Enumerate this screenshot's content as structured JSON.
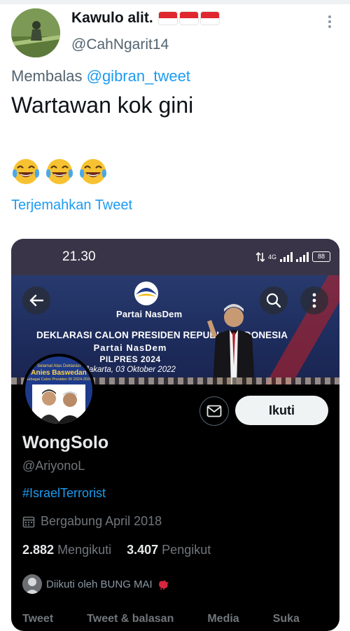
{
  "tweet": {
    "author_name": "Kawulo alit.",
    "author_handle": "@CahNgarit14",
    "reply_prefix": "Membalas",
    "reply_to": "@gibran_tweet",
    "text": "Wartawan kok gini",
    "emojis": [
      "face-with-tears-of-joy",
      "face-with-tears-of-joy",
      "face-with-tears-of-joy"
    ],
    "translate_label": "Terjemahkan Tweet"
  },
  "screenshot": {
    "status_time": "21.30",
    "network_label": "4G",
    "battery_level": "88",
    "banner": {
      "party_logo_text": "Partai NasDem",
      "title": "DEKLARASI CALON PRESIDEN REPUBLIK INDONESIA",
      "party": "Partai NasDem",
      "event": "PILPRES 2024",
      "date": "Jakarta, 03 Oktober 2022"
    },
    "profile_pic": {
      "tagline_top": "Selamat Atas Deklarasi",
      "name": "Anies Baswedan",
      "tagline_bottom": "Sebagai Calon Presiden RI 2024-2029"
    },
    "follow_label": "Ikuti",
    "profile": {
      "name": "WongSolo",
      "handle": "@AriyonoL",
      "hashtag": "#IsraelTerrorist",
      "joined": "Bergabung April 2018",
      "following_count": "2.882",
      "following_label": "Mengikuti",
      "followers_count": "3.407",
      "followers_label": "Pengikut",
      "followed_by": "Diikuti oleh BUNG MAI"
    },
    "tabs": [
      "Tweet",
      "Tweet & balasan",
      "Media",
      "Suka"
    ]
  },
  "colors": {
    "link": "#1d9bf0",
    "text": "#0f1419",
    "muted": "#536471",
    "dark_bg": "#000000"
  }
}
